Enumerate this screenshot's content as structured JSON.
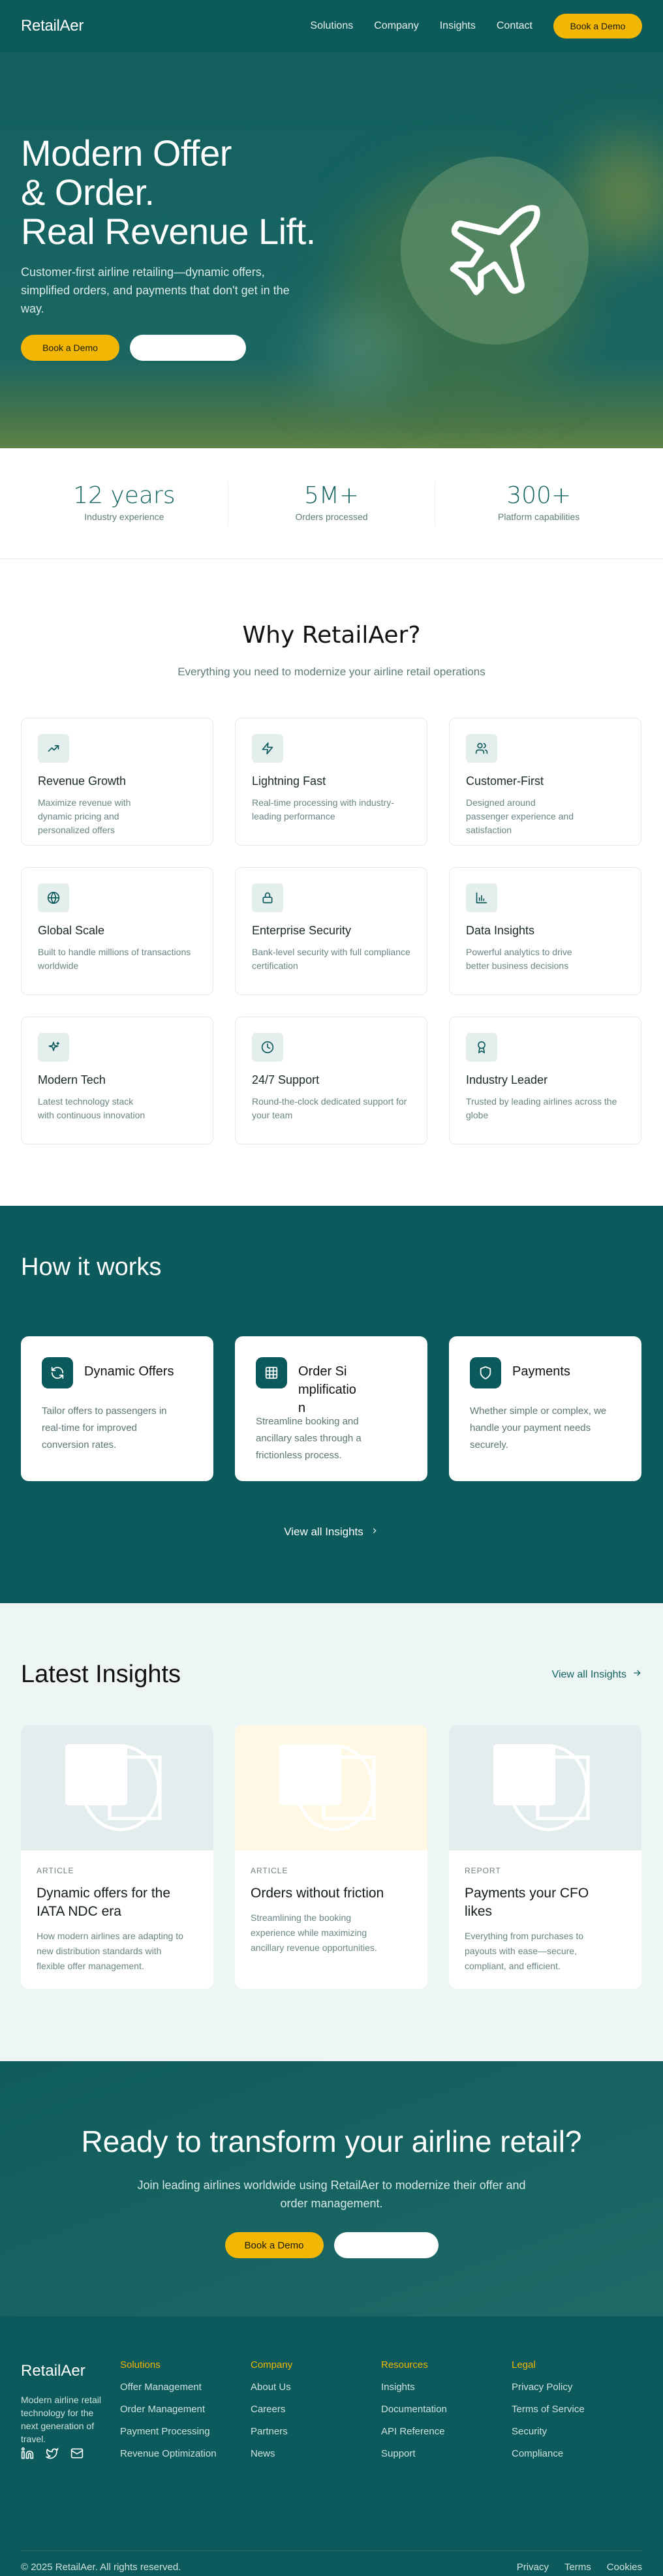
{
  "brand": "RetailAer",
  "colors": {
    "primary": "#0c5a5b",
    "accent": "#f2b705"
  },
  "nav": {
    "items": [
      "Solutions",
      "Company",
      "Insights",
      "Contact"
    ],
    "cta": "Book a Demo"
  },
  "hero": {
    "title_lines": [
      "Modern Offer",
      "& Order.",
      "Real Revenue Lift."
    ],
    "subtitle": "Customer-first airline retailing—dynamic offers, simplified orders, and payments that don't get in the way.",
    "primary_cta": "Book a Demo",
    "secondary_cta": "",
    "icon": "plane-icon"
  },
  "stats": [
    {
      "value": "12 years",
      "label": "Industry experience"
    },
    {
      "value": "5M+",
      "label": "Orders processed"
    },
    {
      "value": "300+",
      "label": "Platform capabilities"
    }
  ],
  "why": {
    "title": "Why RetailAer?",
    "subtitle": "Everything you need to modernize your airline retail operations",
    "features": [
      {
        "icon": "trending-up-icon",
        "title": "Revenue Growth",
        "desc": "Maximize revenue with dynamic pricing and personalized offers"
      },
      {
        "icon": "zap-icon",
        "title": "Lightning Fast",
        "desc": "Real-time processing with industry-leading performance"
      },
      {
        "icon": "users-icon",
        "title": "Customer-First",
        "desc": "Designed around passenger experience and satisfaction"
      },
      {
        "icon": "globe-icon",
        "title": "Global Scale",
        "desc": "Built to handle millions of transactions worldwide"
      },
      {
        "icon": "lock-icon",
        "title": "Enterprise Security",
        "desc": "Bank-level security with full compliance certification"
      },
      {
        "icon": "bar-chart-icon",
        "title": "Data Insights",
        "desc": "Powerful analytics to drive better business decisions"
      },
      {
        "icon": "sparkles-icon",
        "title": "Modern Tech",
        "desc": "Latest technology stack with continuous innovation"
      },
      {
        "icon": "clock-icon",
        "title": "24/7 Support",
        "desc": "Round-the-clock dedicated support for your team"
      },
      {
        "icon": "award-icon",
        "title": "Industry Leader",
        "desc": "Trusted by leading airlines across the globe"
      }
    ]
  },
  "how": {
    "title": "How it works",
    "steps": [
      {
        "icon": "refresh-icon",
        "title": "Dynamic Offers",
        "desc": "Tailor offers to passengers in real-time for improved conversion rates."
      },
      {
        "icon": "grid-icon",
        "title": "Order Simplification",
        "desc": "Streamline booking and ancillary sales through a frictionless process."
      },
      {
        "icon": "shield-icon",
        "title": "Payments",
        "desc": "Whether simple or complex, we handle your payment needs securely."
      }
    ],
    "view_all": "View all Insights"
  },
  "insights": {
    "title": "Latest Insights",
    "view_all": "View all Insights",
    "items": [
      {
        "type": "ARTICLE",
        "title": "Dynamic offers for the IATA NDC era",
        "desc": "How modern airlines are adapting to new distribution standards with flexible offer management.",
        "bg": "#e3eded"
      },
      {
        "type": "ARTICLE",
        "title": "Orders without friction",
        "desc": "Streamlining the booking experience while maximizing ancillary revenue opportunities.",
        "bg": "#fff8e5"
      },
      {
        "type": "REPORT",
        "title": "Payments your CFO likes",
        "desc": "Everything from purchases to payouts with ease—secure, compliant, and efficient.",
        "bg": "#e3eded"
      }
    ]
  },
  "cta": {
    "title": "Ready to transform your airline retail?",
    "subtitle": "Join leading airlines worldwide using RetailAer to modernize their offer and order management.",
    "primary": "Book a Demo",
    "secondary": ""
  },
  "footer": {
    "brand": "RetailAer",
    "tagline": "Modern airline retail technology for the next generation of travel.",
    "social": [
      "linkedin-icon",
      "twitter-icon",
      "mail-icon"
    ],
    "columns": [
      {
        "title": "Solutions",
        "links": [
          "Offer Management",
          "Order Management",
          "Payment Processing",
          "Revenue Optimization"
        ]
      },
      {
        "title": "Company",
        "links": [
          "About Us",
          "Careers",
          "Partners",
          "News"
        ]
      },
      {
        "title": "Resources",
        "links": [
          "Insights",
          "Documentation",
          "API Reference",
          "Support"
        ]
      },
      {
        "title": "Legal",
        "links": [
          "Privacy Policy",
          "Terms of Service",
          "Security",
          "Compliance"
        ]
      }
    ],
    "copyright": "© 2025 RetailAer. All rights reserved.",
    "bottom_links": [
      "Privacy",
      "Terms",
      "Cookies"
    ]
  }
}
